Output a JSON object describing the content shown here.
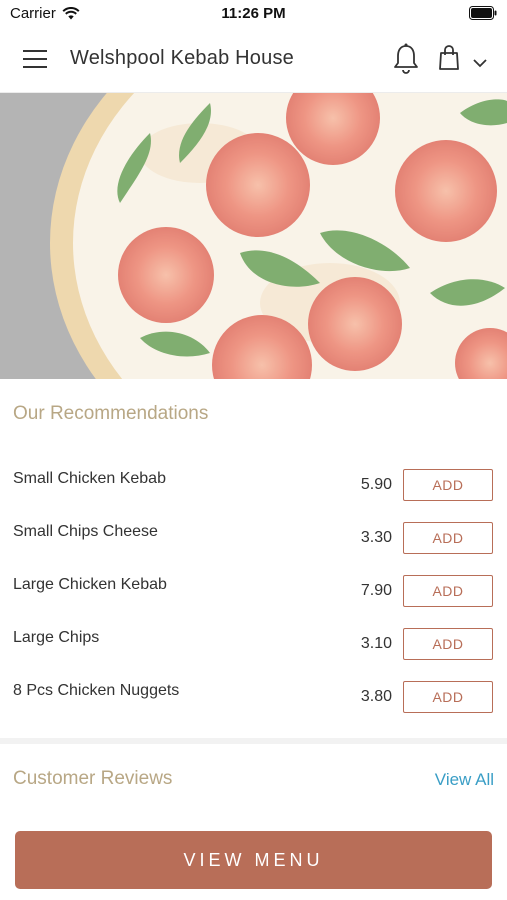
{
  "status_bar": {
    "carrier": "Carrier",
    "time": "11:26 PM"
  },
  "header": {
    "title": "Welshpool Kebab House",
    "icons": [
      "menu-icon",
      "bell-icon",
      "bag-icon",
      "chevron-down-icon"
    ]
  },
  "recommendations": {
    "title": "Our Recommendations",
    "add_label": "ADD",
    "items": [
      {
        "name": "Small Chicken Kebab",
        "price": "5.90"
      },
      {
        "name": "Small Chips Cheese",
        "price": "3.30"
      },
      {
        "name": "Large Chicken Kebab",
        "price": "7.90"
      },
      {
        "name": "Large Chips",
        "price": "3.10"
      },
      {
        "name": "8 Pcs Chicken Nuggets",
        "price": "3.80"
      }
    ]
  },
  "reviews": {
    "title": "Customer Reviews",
    "view_all": "View All"
  },
  "footer": {
    "view_menu": "VIEW MENU"
  },
  "colors": {
    "accent": "#b86e58",
    "section_title": "#b8a785",
    "link": "#3a9ec6"
  }
}
